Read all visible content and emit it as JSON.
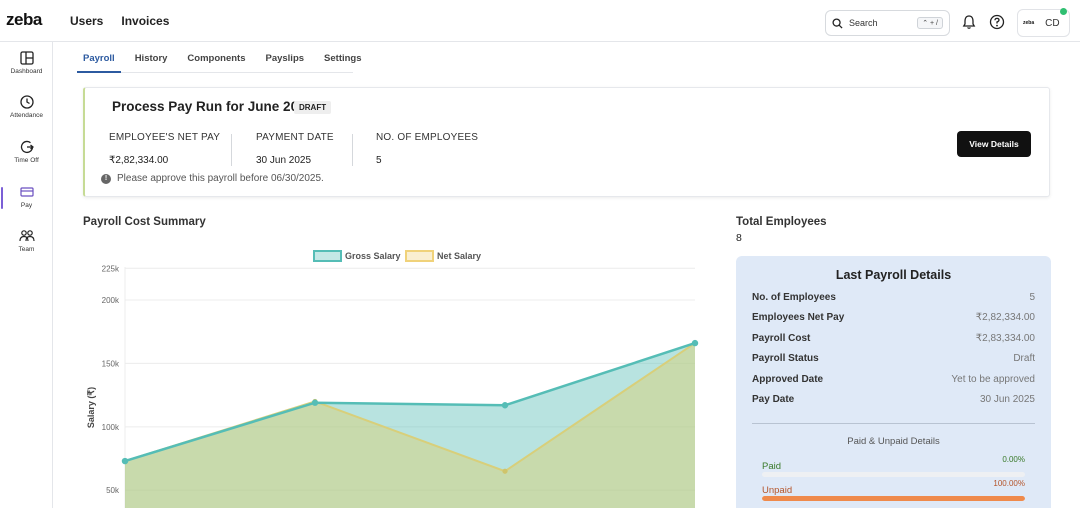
{
  "app": {
    "logo": "zeba"
  },
  "topnav": {
    "users": "Users",
    "invoices": "Invoices"
  },
  "search": {
    "placeholder": "Search",
    "shortcut": "⌃ + /"
  },
  "user": {
    "avatar_logo": "zeba",
    "initials": "CD"
  },
  "sidebar": {
    "items": [
      {
        "label": "Dashboard",
        "icon": "layout-icon"
      },
      {
        "label": "Attendance",
        "icon": "clock-icon"
      },
      {
        "label": "Time Off",
        "icon": "timeoff-icon"
      },
      {
        "label": "Pay",
        "icon": "pay-icon"
      },
      {
        "label": "Team",
        "icon": "team-icon"
      }
    ]
  },
  "tabs": [
    "Payroll",
    "History",
    "Components",
    "Payslips",
    "Settings"
  ],
  "payrun": {
    "title": "Process Pay Run for June 2025",
    "status": "DRAFT",
    "net_pay_label": "EMPLOYEE'S NET PAY",
    "net_pay_value": "₹2,82,334.00",
    "payment_date_label": "PAYMENT DATE",
    "payment_date_value": "30 Jun 2025",
    "employees_label": "NO. OF EMPLOYEES",
    "employees_value": "5",
    "note": "Please approve this payroll before 06/30/2025.",
    "view_button": "View Details"
  },
  "summary": {
    "title": "Payroll Cost Summary"
  },
  "chart_data": {
    "type": "area",
    "x": [
      "",
      "",
      "",
      ""
    ],
    "series": [
      {
        "name": "Gross Salary",
        "values": [
          73000,
          119000,
          117000,
          166000
        ],
        "color": "#55bdb6"
      },
      {
        "name": "Net Salary",
        "values": [
          73000,
          120000,
          65000,
          166000
        ],
        "color": "#f0d27a"
      }
    ],
    "ylabel": "Salary (₹)",
    "ylim": [
      36000,
      226000
    ],
    "yticks": [
      50000,
      100000,
      150000,
      200000,
      225000
    ],
    "ytick_labels": [
      "50k",
      "100k",
      "150k",
      "200k",
      "225k"
    ],
    "legend": "top-center",
    "grid": true
  },
  "total": {
    "label": "Total Employees",
    "value": "8"
  },
  "last_payroll": {
    "title": "Last Payroll Details",
    "rows": [
      {
        "k": "No. of Employees",
        "v": "5"
      },
      {
        "k": "Employees Net Pay",
        "v": "₹2,82,334.00"
      },
      {
        "k": "Payroll Cost",
        "v": "₹2,83,334.00"
      },
      {
        "k": "Payroll Status",
        "v": "Draft"
      },
      {
        "k": "Approved Date",
        "v": "Yet to be approved"
      },
      {
        "k": "Pay Date",
        "v": "30 Jun 2025"
      }
    ],
    "subheading": "Paid & Unpaid Details",
    "paid": {
      "label": "Paid",
      "pct_text": "0.00%",
      "pct": 0,
      "color": "#3a7a2a"
    },
    "unpaid": {
      "label": "Unpaid",
      "pct_text": "100.00%",
      "pct": 100,
      "color": "#b5552a",
      "bar_color": "#ef8a4c"
    }
  }
}
